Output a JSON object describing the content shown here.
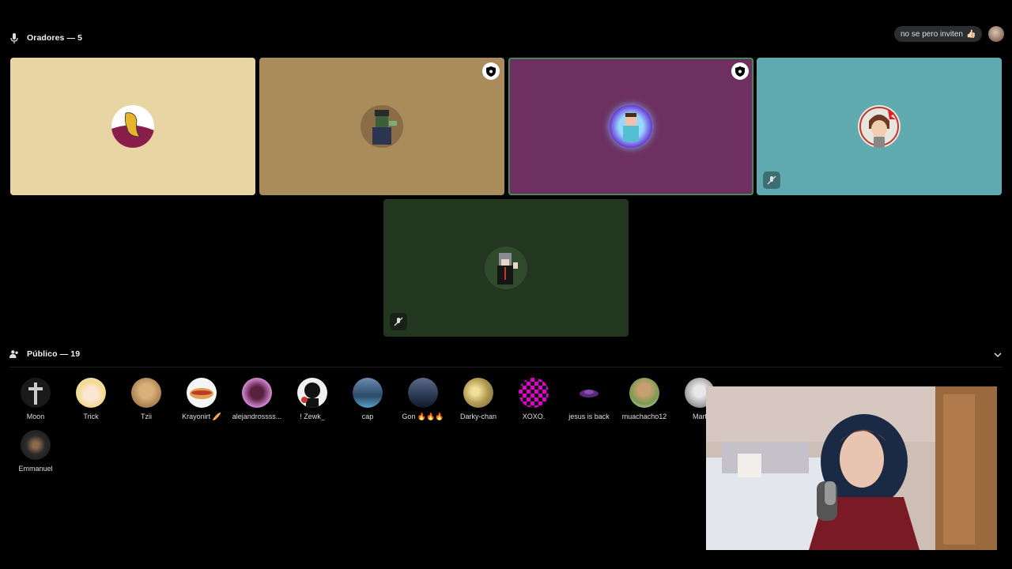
{
  "speakers": {
    "title": "Oradores — 5",
    "tiles": [
      {
        "name": "speaker-1",
        "bg": "#e9d5a3",
        "moderator": false,
        "muted": false
      },
      {
        "name": "speaker-2",
        "bg": "#a98b5c",
        "moderator": true,
        "muted": false
      },
      {
        "name": "speaker-3",
        "bg": "#6d3060",
        "moderator": true,
        "muted": false,
        "speaking": true
      },
      {
        "name": "speaker-4",
        "bg": "#5eaaaf",
        "moderator": false,
        "muted": true
      },
      {
        "name": "speaker-5",
        "bg": "#23361f",
        "moderator": false,
        "muted": true
      }
    ]
  },
  "status": {
    "text": "no se pero inviten",
    "emoji": "👍🏻"
  },
  "audience": {
    "title": "Público — 19",
    "members": [
      {
        "name": "Moon",
        "color": "#3a3a3a"
      },
      {
        "name": "Trick",
        "color": "#f3d98a"
      },
      {
        "name": "Tzii",
        "color": "#a88050"
      },
      {
        "name": "Krayonirt 🥖",
        "color": "#d07a3a"
      },
      {
        "name": "alejandrossss...",
        "color": "#d58ad6"
      },
      {
        "name": "! Zewk_",
        "color": "#e8e8e8"
      },
      {
        "name": "cap",
        "color": "#4a7ea8"
      },
      {
        "name": "Gon 🔥🔥🔥",
        "color": "#2e3e5a"
      },
      {
        "name": "Darky-chan",
        "color": "#b59a52"
      },
      {
        "name": "XOXO.",
        "color": "#e000c8"
      },
      {
        "name": "jesus is back",
        "color": "#3a1a4a"
      },
      {
        "name": "muachacho12",
        "color": "#7a9a50"
      },
      {
        "name": "Mart",
        "color": "#aaaaaa"
      },
      {
        "name": "Emmanuel",
        "color": "#3a3a3a"
      }
    ]
  },
  "webcam": {
    "label": "webcam-overlay"
  }
}
